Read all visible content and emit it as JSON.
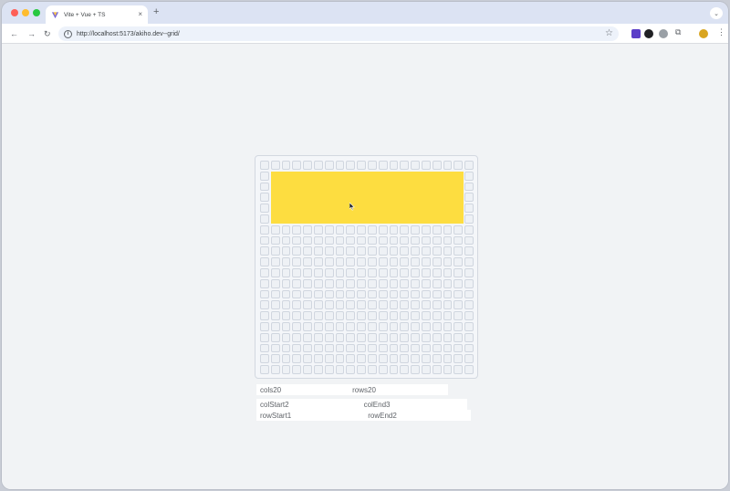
{
  "browser": {
    "tab_title": "Vite + Vue + TS",
    "tab_close": "×",
    "new_tab": "+",
    "url": "http://localhost:5173/akiho.dev--grid/",
    "nav_back": "←",
    "nav_forward": "→",
    "nav_reload": "↻",
    "star": "☆",
    "tab_menu": "⌄",
    "menu": "⋮",
    "puzzle": "⧉",
    "colors": {
      "tab_strip": "#dce3f3",
      "omnibox": "#edf2fa"
    }
  },
  "grid": {
    "cols": 20,
    "rows": 20,
    "selection": {
      "col_start": 2,
      "col_end": 3,
      "row_start": 1,
      "row_end": 2
    },
    "selection_color": "#fddd40",
    "cursor_icon": "pointer-cursor-icon"
  },
  "controls": {
    "cols": {
      "label": "cols",
      "value": "20"
    },
    "rows": {
      "label": "rows",
      "value": "20"
    },
    "col_start": {
      "label": "colStart",
      "value": "2"
    },
    "col_end": {
      "label": "colEnd",
      "value": "3"
    },
    "row_start": {
      "label": "rowStart",
      "value": "1"
    },
    "row_end": {
      "label": "rowEnd",
      "value": "2"
    }
  }
}
